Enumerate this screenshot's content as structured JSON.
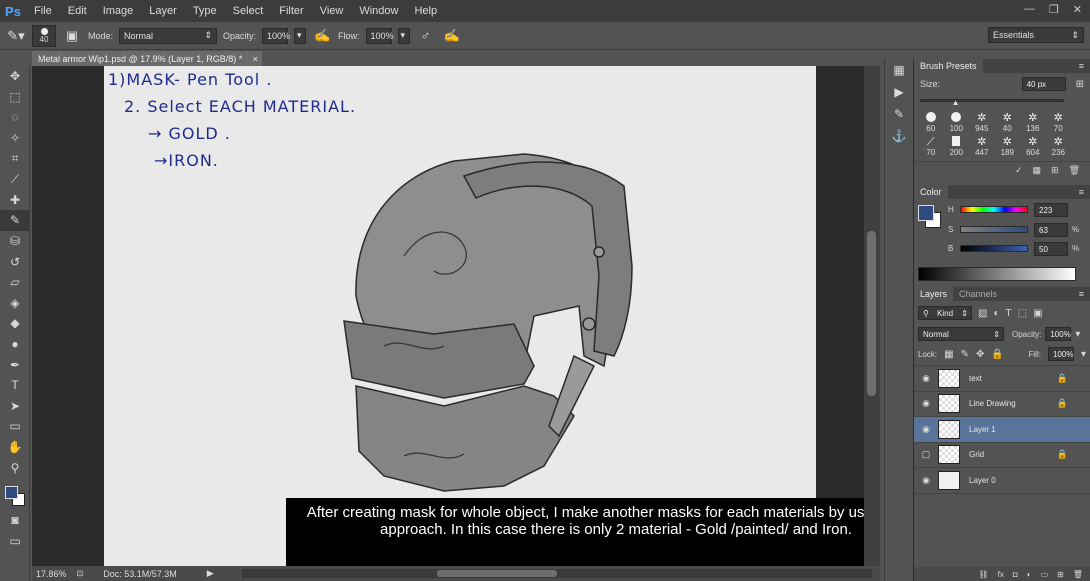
{
  "app": {
    "logo": "Ps",
    "window_controls": [
      "—",
      "❐",
      "✕"
    ]
  },
  "menu": [
    "File",
    "Edit",
    "Image",
    "Layer",
    "Type",
    "Select",
    "Filter",
    "View",
    "Window",
    "Help"
  ],
  "options_bar": {
    "brush_size": "40",
    "mode_label": "Mode:",
    "mode_value": "Normal",
    "opacity_label": "Opacity:",
    "opacity_value": "100%",
    "flow_label": "Flow:",
    "flow_value": "100%",
    "workspace": "Essentials"
  },
  "document": {
    "tab_title": "Metal armor Wip1.psd @ 17.9% (Layer 1, RGB/8) *",
    "close": "×",
    "notes": [
      "1)MASK- Pen Tool .",
      "2. Select EACH MATERIAL.",
      "→ GOLD .",
      "→IRON."
    ],
    "subtitle": "After creating mask for whole object, I make another masks for each materials by using same approach. In this case there is only 2 material - Gold /painted/ and Iron."
  },
  "status": {
    "zoom": "17.86%",
    "doc": "Doc: 53.1M/57.3M"
  },
  "brush_presets": {
    "title": "Brush Presets",
    "size_label": "Size:",
    "size_value": "40 px",
    "size_fraction": 0.22,
    "brushes": [
      {
        "n": "60",
        "kind": "round"
      },
      {
        "n": "100",
        "kind": "round"
      },
      {
        "n": "945",
        "kind": "splat"
      },
      {
        "n": "40",
        "kind": "splat"
      },
      {
        "n": "136",
        "kind": "splat"
      },
      {
        "n": "70",
        "kind": "splat"
      },
      {
        "n": "70",
        "kind": "stroke"
      },
      {
        "n": "200",
        "kind": "square"
      },
      {
        "n": "447",
        "kind": "splat"
      },
      {
        "n": "189",
        "kind": "splat"
      },
      {
        "n": "604",
        "kind": "splat"
      },
      {
        "n": "236",
        "kind": "splat"
      }
    ]
  },
  "color": {
    "title": "Color",
    "h_label": "H",
    "h_value": "223",
    "s_label": "S",
    "s_value": "63",
    "b_label": "B",
    "b_value": "50",
    "pct": "%",
    "foreground": "#2f4a80",
    "background": "#ffffff"
  },
  "layers": {
    "tabs": [
      "Layers",
      "Channels"
    ],
    "kind_label": "Kind",
    "blend_mode": "Normal",
    "opacity_label": "Opacity:",
    "opacity_value": "100%",
    "lock_label": "Lock:",
    "fill_label": "Fill:",
    "fill_value": "100%",
    "items": [
      {
        "name": "text",
        "visible": true,
        "locked": true,
        "selected": false
      },
      {
        "name": "Line Drawing",
        "visible": true,
        "locked": true,
        "selected": false
      },
      {
        "name": "Layer 1",
        "visible": true,
        "locked": false,
        "selected": true
      },
      {
        "name": "Grid",
        "visible": false,
        "locked": true,
        "selected": false
      },
      {
        "name": "Layer 0",
        "visible": true,
        "locked": false,
        "selected": false
      }
    ],
    "footer_icons": [
      "link-icon",
      "fx-icon",
      "mask-icon",
      "adjustment-icon",
      "folder-icon",
      "new-layer-icon",
      "trash-icon"
    ]
  }
}
